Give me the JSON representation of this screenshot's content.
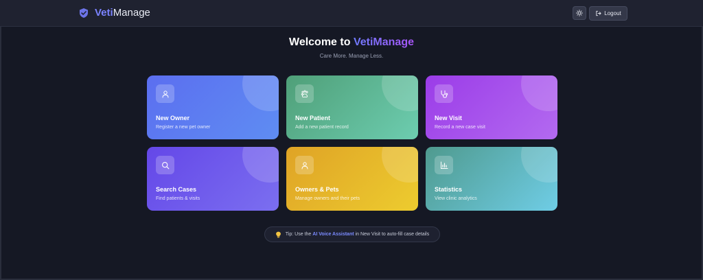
{
  "navbar": {
    "brand_accent": "Veti",
    "brand_rest": "Manage",
    "logout_label": "Logout",
    "icons": {
      "brand": "shield-check-icon",
      "theme": "sun-icon",
      "logout": "logout-icon"
    }
  },
  "hero": {
    "title_prefix": "Welcome to",
    "title_accent": "VetiManage",
    "subtitle": "Care More. Manage Less."
  },
  "cards": [
    {
      "title": "New Owner",
      "description": "Register a new pet owner",
      "icon": "user-icon",
      "color": "#5b6ef0"
    },
    {
      "title": "New Patient",
      "description": "Add a new patient record",
      "icon": "paw-icon",
      "color": "#4f9f78"
    },
    {
      "title": "New Visit",
      "description": "Record a new case visit",
      "icon": "stethoscope-icon",
      "color": "#9b3ce8"
    },
    {
      "title": "Search Cases",
      "description": "Find patients & visits",
      "icon": "search-icon",
      "color": "#6447e8"
    },
    {
      "title": "Owners & Pets",
      "description": "Manage owners and their pets",
      "icon": "user-icon",
      "color": "#dfa326"
    },
    {
      "title": "Statistics",
      "description": "View clinic analytics",
      "icon": "bar-chart-icon",
      "color": "#4f9a8e"
    }
  ],
  "tip": {
    "prefix": "Tip: Use the",
    "highlight": "AI Voice Assistant",
    "suffix": "in New Visit to auto-fill case details",
    "icon": "lightbulb-icon"
  }
}
